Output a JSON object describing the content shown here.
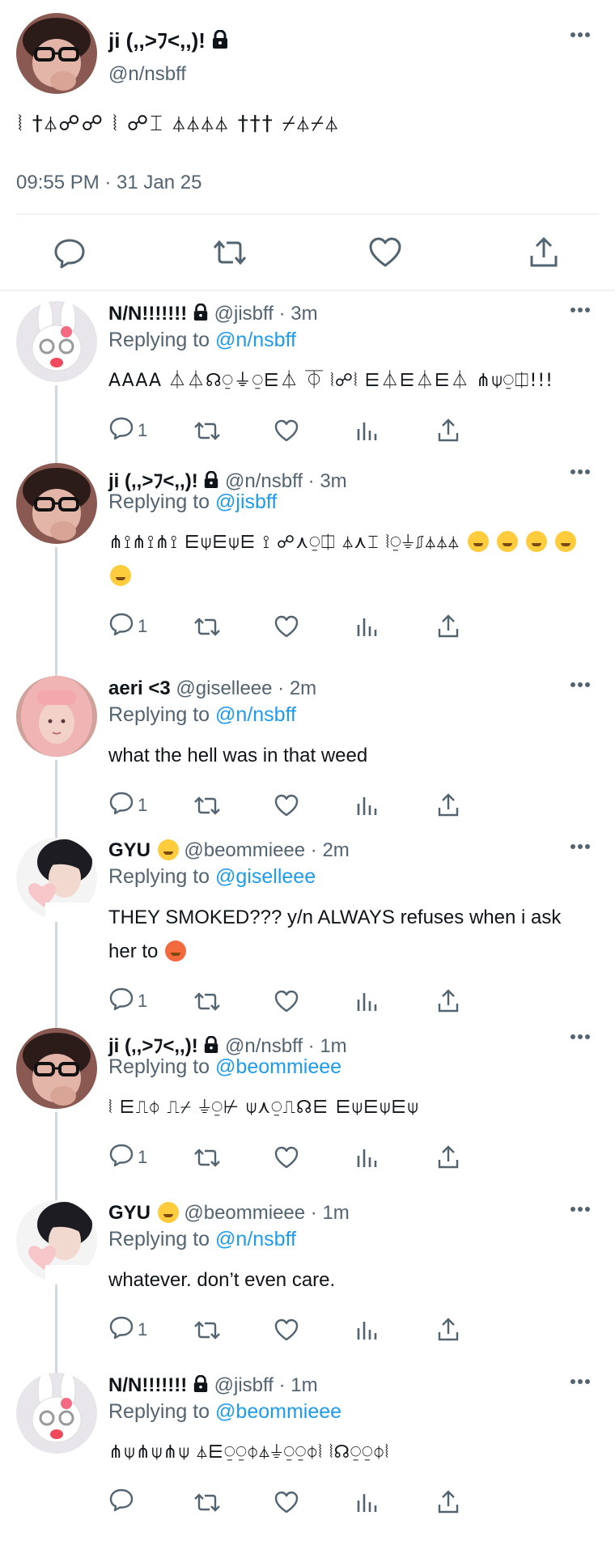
{
  "main_tweet": {
    "name": "ji (,,>ﾌ<,,)!",
    "handle": "@n/nsbff",
    "text": "⦚ †⏃☍☍ ⦚ ☍⌶ ⏃⏃⏃⏃ ††† ⌿⏃⌿⏃",
    "timestamp": "09:55 PM · 31 Jan 25",
    "icons": [
      "reply-icon",
      "retweet-icon",
      "like-icon",
      "share-icon"
    ]
  },
  "replies": [
    {
      "name": "N/N!!!!!!!",
      "handle_time": "@jisbff · 3m",
      "replying_prefix": "Replying to ",
      "replying_to": "@n/nsbff",
      "text": "AAAA ⏃⏃☊⍜⏚⍜⋿⏃ ⏁ ⦚☍⦚ ⋿⏃⋿⏃⋿⏃ ⋔⍦⍜⎅!!!",
      "glyph": true,
      "emojis": [],
      "reply_count": "1",
      "avatar": "bunny"
    },
    {
      "name": "ji (,,>ﾌ<,,)!",
      "handle_time": "@n/nsbff · 3m",
      "replying_prefix": "Replying to ",
      "replying_to": "@jisbff",
      "text": "⋔⟟⋔⟟⋔⟟ ⋿⍦⋿⍦⋿ ⟟ ☍⋏⍜⎅ ⏃⋏⌶ ⦚⍜⏚⎎⏃⏃⏃",
      "glyph": true,
      "emojis": [
        "kissing-emoji",
        "kissing-emoji",
        "kissing-closed-eyes-emoji",
        "kiss-emoji",
        "smile-emoji"
      ],
      "reply_count": "1",
      "avatar": "ji"
    },
    {
      "name": "aeri <3",
      "handle_time": "@giselleee · 2m",
      "replying_prefix": "Replying to ",
      "replying_to": "@n/nsbff",
      "text": "what the hell was in that weed",
      "glyph": false,
      "emojis": [],
      "reply_count": "1",
      "avatar": "aeri"
    },
    {
      "name": "GYU",
      "name_emoji": "tongue-emoji",
      "handle_time": "@beommieee · 2m",
      "replying_prefix": "Replying to ",
      "replying_to": "@giselleee",
      "text": "THEY SMOKED??? y/n ALWAYS refuses when i ask her to",
      "glyph": false,
      "emojis": [
        "angry-emoji"
      ],
      "reply_count": "1",
      "avatar": "gyu"
    },
    {
      "name": "ji (,,>ﾌ<,,)!",
      "handle_time": "@n/nsbff · 1m",
      "replying_prefix": "Replying to ",
      "replying_to": "@beommieee",
      "text": "⦚ ⋿⎍⏀ ⎍⌿ ⏚⍜⊬ ⍦⋏⍜⎍☊⋿ ⋿⍦⋿⍦⋿⍦",
      "glyph": true,
      "emojis": [],
      "reply_count": "1",
      "avatar": "ji"
    },
    {
      "name": "GYU",
      "name_emoji": "tongue-emoji",
      "handle_time": "@beommieee · 1m",
      "replying_prefix": "Replying to ",
      "replying_to": "@n/nsbff",
      "text": "whatever. don’t even care.",
      "glyph": false,
      "emojis": [],
      "reply_count": "1",
      "avatar": "gyu"
    },
    {
      "name": "N/N!!!!!!!",
      "handle_time": "@jisbff · 1m",
      "replying_prefix": "Replying to ",
      "replying_to": "@beommieee",
      "text": "⋔⍦⋔⍦⋔⍦ ⏃⋿⍜⍜⏀⏃⏚⍜⍜⏀⦚ ⦚☊⍜⍜⏀⦚",
      "glyph": true,
      "emojis": [],
      "reply_count": "",
      "avatar": "bunny"
    }
  ],
  "colors": {
    "link": "#1d9bf0",
    "muted": "#536471",
    "text": "#0f1419",
    "divider": "#e1e6ea"
  }
}
